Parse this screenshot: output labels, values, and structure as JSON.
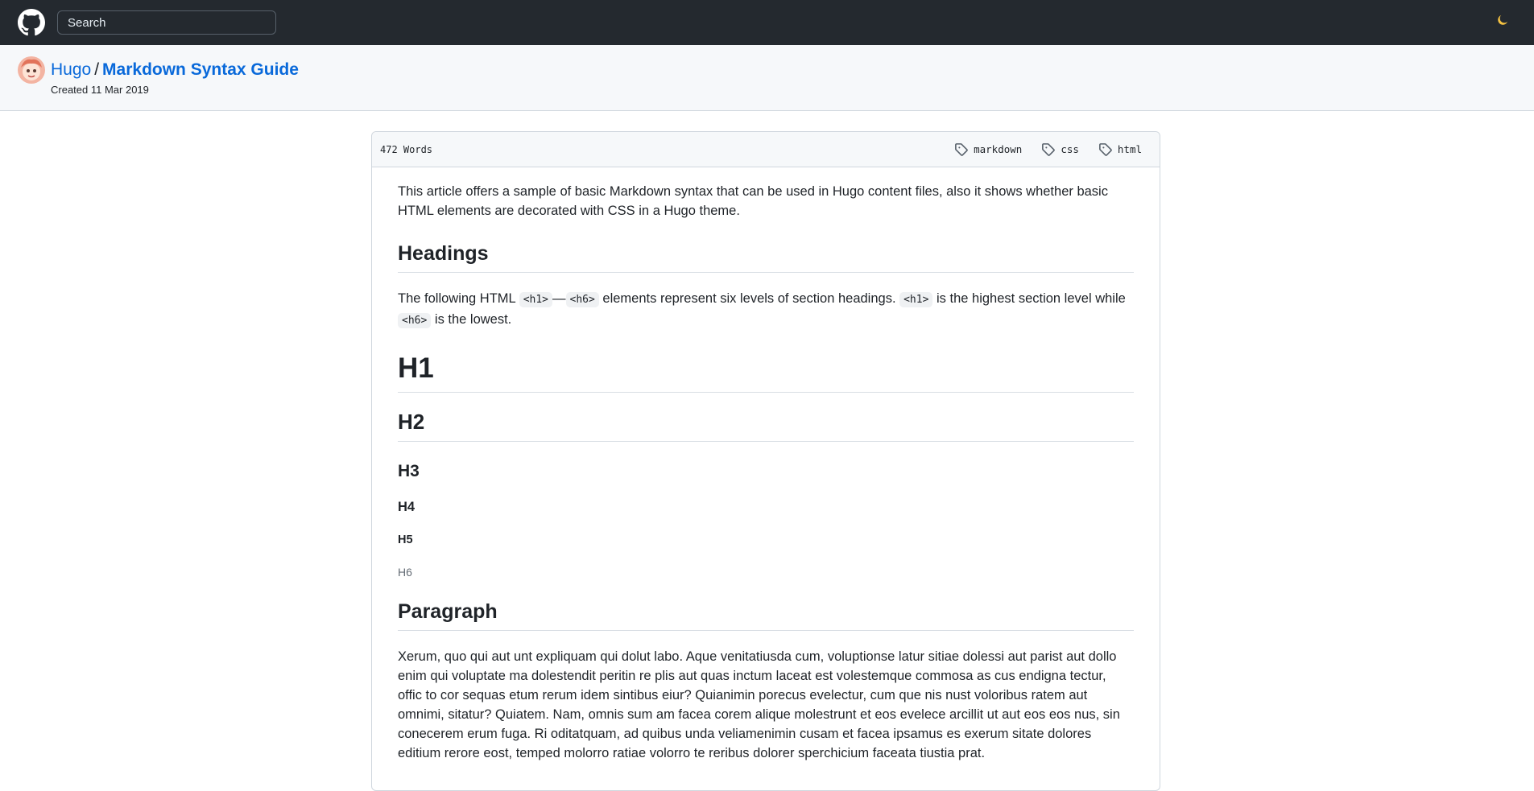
{
  "topbar": {
    "search_placeholder": "Search",
    "logo_icon": "github-mark-icon",
    "theme_icon": "moon-icon"
  },
  "header": {
    "owner": "Hugo",
    "separator": "/",
    "title": "Markdown Syntax Guide",
    "created": "Created 11 Mar 2019"
  },
  "article": {
    "word_count": "472 Words",
    "tags": [
      "markdown",
      "css",
      "html"
    ],
    "intro": "This article offers a sample of basic Markdown syntax that can be used in Hugo content files, also it shows whether basic HTML elements are decorated with CSS in a Hugo theme.",
    "headings_title": "Headings",
    "headings_text": {
      "part1": "The following HTML ",
      "code1": "<h1>",
      "dash": "—",
      "code2": "<h6>",
      "part2": " elements represent six levels of section headings. ",
      "code3": "<h1>",
      "part3": " is the highest section level while ",
      "code4": "<h6>",
      "part4": " is the lowest."
    },
    "demo_headings": [
      "H1",
      "H2",
      "H3",
      "H4",
      "H5",
      "H6"
    ],
    "paragraph_title": "Paragraph",
    "paragraph_text": "Xerum, quo qui aut unt expliquam qui dolut labo. Aque venitatiusda cum, voluptionse latur sitiae dolessi aut parist aut dollo enim qui voluptate ma dolestendit peritin re plis aut quas inctum laceat est volestemque commosa as cus endigna tectur, offic to cor sequas etum rerum idem sintibus eiur? Quianimin porecus evelectur, cum que nis nust voloribus ratem aut omnimi, sitatur? Quiatem. Nam, omnis sum am facea corem alique molestrunt et eos evelece arcillit ut aut eos eos nus, sin conecerem erum fuga. Ri oditatquam, ad quibus unda veliamenimin cusam et facea ipsamus es exerum sitate dolores editium rerore eost, temped molorro ratiae volorro te reribus dolorer sperchicium faceata tiustia prat."
  },
  "colors": {
    "topbar": "#24292f",
    "link": "#0969da",
    "header_bg": "#f6f8fa"
  }
}
